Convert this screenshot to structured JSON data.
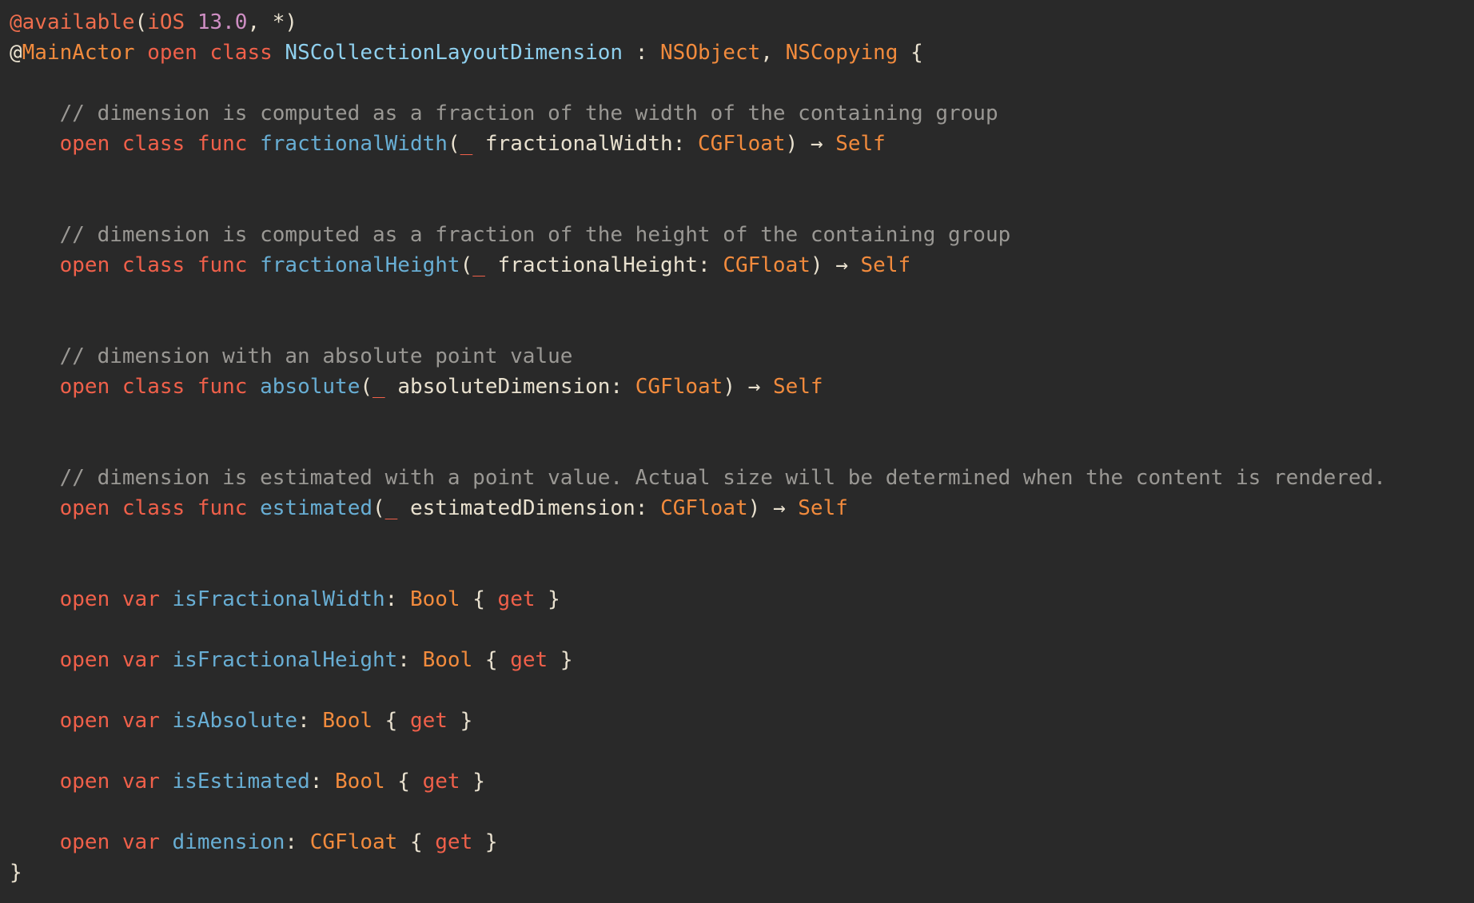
{
  "editor": {
    "lines": [
      [
        [
          "attr",
          "@available"
        ],
        [
          "plain",
          "("
        ],
        [
          "attr",
          "iOS"
        ],
        [
          "plain",
          " "
        ],
        [
          "num",
          "13.0"
        ],
        [
          "plain",
          ", *)"
        ]
      ],
      [
        [
          "plain",
          "@"
        ],
        [
          "type",
          "MainActor"
        ],
        [
          "plain",
          " "
        ],
        [
          "kw",
          "open"
        ],
        [
          "plain",
          " "
        ],
        [
          "kw",
          "class"
        ],
        [
          "plain",
          " "
        ],
        [
          "class",
          "NSCollectionLayoutDimension"
        ],
        [
          "plain",
          " : "
        ],
        [
          "type",
          "NSObject"
        ],
        [
          "plain",
          ", "
        ],
        [
          "type",
          "NSCopying"
        ],
        [
          "plain",
          " {"
        ]
      ],
      [],
      [
        [
          "cm",
          "    // dimension is computed as a fraction of the width of the containing group"
        ]
      ],
      [
        [
          "plain",
          "    "
        ],
        [
          "kw",
          "open"
        ],
        [
          "plain",
          " "
        ],
        [
          "kw",
          "class"
        ],
        [
          "plain",
          " "
        ],
        [
          "kw",
          "func"
        ],
        [
          "plain",
          " "
        ],
        [
          "fn",
          "fractionalWidth"
        ],
        [
          "plain",
          "("
        ],
        [
          "kw",
          "_"
        ],
        [
          "plain",
          " fractionalWidth: "
        ],
        [
          "type",
          "CGFloat"
        ],
        [
          "plain",
          ") → "
        ],
        [
          "type",
          "Self"
        ]
      ],
      [],
      [],
      [
        [
          "cm",
          "    // dimension is computed as a fraction of the height of the containing group"
        ]
      ],
      [
        [
          "plain",
          "    "
        ],
        [
          "kw",
          "open"
        ],
        [
          "plain",
          " "
        ],
        [
          "kw",
          "class"
        ],
        [
          "plain",
          " "
        ],
        [
          "kw",
          "func"
        ],
        [
          "plain",
          " "
        ],
        [
          "fn",
          "fractionalHeight"
        ],
        [
          "plain",
          "("
        ],
        [
          "kw",
          "_"
        ],
        [
          "plain",
          " fractionalHeight: "
        ],
        [
          "type",
          "CGFloat"
        ],
        [
          "plain",
          ") → "
        ],
        [
          "type",
          "Self"
        ]
      ],
      [],
      [],
      [
        [
          "cm",
          "    // dimension with an absolute point value"
        ]
      ],
      [
        [
          "plain",
          "    "
        ],
        [
          "kw",
          "open"
        ],
        [
          "plain",
          " "
        ],
        [
          "kw",
          "class"
        ],
        [
          "plain",
          " "
        ],
        [
          "kw",
          "func"
        ],
        [
          "plain",
          " "
        ],
        [
          "fn",
          "absolute"
        ],
        [
          "plain",
          "("
        ],
        [
          "kw",
          "_"
        ],
        [
          "plain",
          " absoluteDimension: "
        ],
        [
          "type",
          "CGFloat"
        ],
        [
          "plain",
          ") → "
        ],
        [
          "type",
          "Self"
        ]
      ],
      [],
      [],
      [
        [
          "cm",
          "    // dimension is estimated with a point value. Actual size will be determined when the content is rendered."
        ]
      ],
      [
        [
          "plain",
          "    "
        ],
        [
          "kw",
          "open"
        ],
        [
          "plain",
          " "
        ],
        [
          "kw",
          "class"
        ],
        [
          "plain",
          " "
        ],
        [
          "kw",
          "func"
        ],
        [
          "plain",
          " "
        ],
        [
          "fn",
          "estimated"
        ],
        [
          "plain",
          "("
        ],
        [
          "kw",
          "_"
        ],
        [
          "plain",
          " estimatedDimension: "
        ],
        [
          "type",
          "CGFloat"
        ],
        [
          "plain",
          ") → "
        ],
        [
          "type",
          "Self"
        ]
      ],
      [],
      [],
      [
        [
          "plain",
          "    "
        ],
        [
          "kw",
          "open"
        ],
        [
          "plain",
          " "
        ],
        [
          "kw",
          "var"
        ],
        [
          "plain",
          " "
        ],
        [
          "fn",
          "isFractionalWidth"
        ],
        [
          "plain",
          ": "
        ],
        [
          "type",
          "Bool"
        ],
        [
          "plain",
          " { "
        ],
        [
          "kw",
          "get"
        ],
        [
          "plain",
          " }"
        ]
      ],
      [],
      [
        [
          "plain",
          "    "
        ],
        [
          "kw",
          "open"
        ],
        [
          "plain",
          " "
        ],
        [
          "kw",
          "var"
        ],
        [
          "plain",
          " "
        ],
        [
          "fn",
          "isFractionalHeight"
        ],
        [
          "plain",
          ": "
        ],
        [
          "type",
          "Bool"
        ],
        [
          "plain",
          " { "
        ],
        [
          "kw",
          "get"
        ],
        [
          "plain",
          " }"
        ]
      ],
      [],
      [
        [
          "plain",
          "    "
        ],
        [
          "kw",
          "open"
        ],
        [
          "plain",
          " "
        ],
        [
          "kw",
          "var"
        ],
        [
          "plain",
          " "
        ],
        [
          "fn",
          "isAbsolute"
        ],
        [
          "plain",
          ": "
        ],
        [
          "type",
          "Bool"
        ],
        [
          "plain",
          " { "
        ],
        [
          "kw",
          "get"
        ],
        [
          "plain",
          " }"
        ]
      ],
      [],
      [
        [
          "plain",
          "    "
        ],
        [
          "kw",
          "open"
        ],
        [
          "plain",
          " "
        ],
        [
          "kw",
          "var"
        ],
        [
          "plain",
          " "
        ],
        [
          "fn",
          "isEstimated"
        ],
        [
          "plain",
          ": "
        ],
        [
          "type",
          "Bool"
        ],
        [
          "plain",
          " { "
        ],
        [
          "kw",
          "get"
        ],
        [
          "plain",
          " }"
        ]
      ],
      [],
      [
        [
          "plain",
          "    "
        ],
        [
          "kw",
          "open"
        ],
        [
          "plain",
          " "
        ],
        [
          "kw",
          "var"
        ],
        [
          "plain",
          " "
        ],
        [
          "fn",
          "dimension"
        ],
        [
          "plain",
          ": "
        ],
        [
          "type",
          "CGFloat"
        ],
        [
          "plain",
          " { "
        ],
        [
          "kw",
          "get"
        ],
        [
          "plain",
          " }"
        ]
      ],
      [
        [
          "plain",
          "}"
        ]
      ]
    ]
  }
}
